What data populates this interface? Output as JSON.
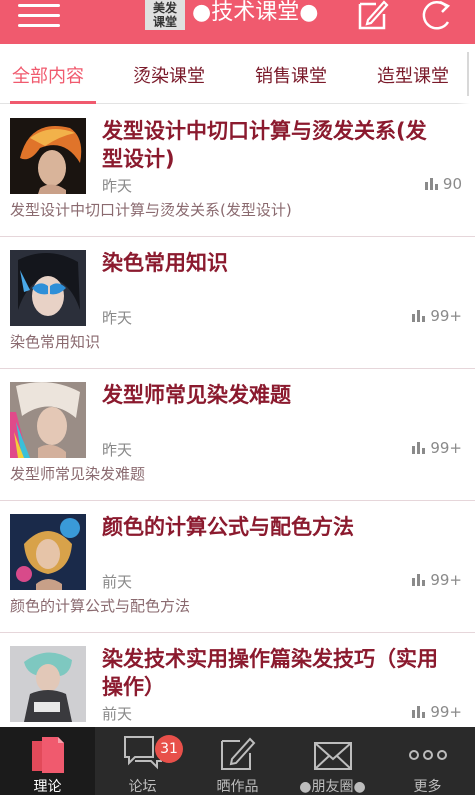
{
  "header": {
    "logo_line1": "美发",
    "logo_line2": "课堂",
    "title": "●技术课堂●"
  },
  "tabs": [
    {
      "label": "全部内容",
      "active": true
    },
    {
      "label": "烫染课堂",
      "active": false
    },
    {
      "label": "销售课堂",
      "active": false
    },
    {
      "label": "造型课堂",
      "active": false
    }
  ],
  "articles": [
    {
      "title": "发型设计中切口计算与烫发关系(发型设计)",
      "time": "昨天",
      "views": "90",
      "desc": "发型设计中切口计算与烫发关系(发型设计)"
    },
    {
      "title": "染色常用知识",
      "time": "昨天",
      "views": "99+",
      "desc": "染色常用知识"
    },
    {
      "title": "发型师常见染发难题",
      "time": "昨天",
      "views": "99+",
      "desc": "发型师常见染发难题"
    },
    {
      "title": "颜色的计算公式与配色方法",
      "time": "前天",
      "views": "99+",
      "desc": "颜色的计算公式与配色方法"
    },
    {
      "title": "染发技术实用操作篇染发技巧（实用操作）",
      "time": "前天",
      "views": "99+",
      "desc": ""
    }
  ],
  "bottom_nav": [
    {
      "label": "理论",
      "icon": "document-icon",
      "active": true
    },
    {
      "label": "论坛",
      "icon": "chat-icon",
      "badge": "31"
    },
    {
      "label": "晒作品",
      "icon": "edit-icon"
    },
    {
      "label": "●朋友圈●",
      "icon": "mail-icon"
    },
    {
      "label": "更多",
      "icon": "more-icon"
    }
  ],
  "colors": {
    "brand": "#f05a6e",
    "title_text": "#8b1a2e",
    "nav_bg": "#2a2a2a",
    "badge": "#e8504a"
  }
}
